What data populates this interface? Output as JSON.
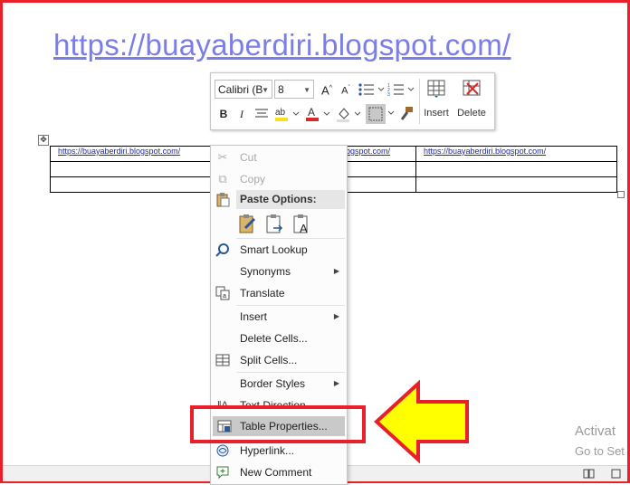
{
  "document": {
    "heading_link": "https://buayaberdiri.blogspot.com/",
    "table_cells": [
      [
        "https://buayaberdiri.blogspot.com/",
        "https://buayaberdiri.blogspot.com/",
        "https://buayaberdiri.blogspot.com/"
      ],
      [
        "",
        "",
        ""
      ],
      [
        "",
        "",
        ""
      ]
    ],
    "middle_cell_visible": "logspot.com/"
  },
  "mini_toolbar": {
    "font_name": "Calibri (B",
    "font_size": "8",
    "insert_label": "Insert",
    "delete_label": "Delete",
    "font_color": "#d42a2a",
    "highlight_color": "#f5e11c"
  },
  "context_menu": {
    "items": [
      {
        "label": "Cut",
        "icon": "scissors-icon",
        "disabled": true
      },
      {
        "label": "Copy",
        "icon": "copy-icon",
        "disabled": true
      },
      {
        "label": "Paste Options:",
        "icon": "paste-icon",
        "header": true
      },
      {
        "label": "Smart Lookup",
        "icon": "search-icon"
      },
      {
        "label": "Synonyms",
        "submenu": true
      },
      {
        "label": "Translate",
        "icon": "translate-icon"
      },
      {
        "label": "Insert",
        "submenu": true
      },
      {
        "label": "Delete Cells..."
      },
      {
        "label": "Split Cells...",
        "icon": "split-cells-icon"
      },
      {
        "label": "Border Styles",
        "submenu": true
      },
      {
        "label": "Text Direction...",
        "icon": "text-direction-icon"
      },
      {
        "label": "Table Properties...",
        "icon": "table-properties-icon",
        "highlighted": true
      },
      {
        "label": "Hyperlink...",
        "icon": "link-icon"
      },
      {
        "label": "New Comment",
        "icon": "comment-icon"
      }
    ]
  },
  "activation": {
    "line1": "Activat",
    "line2": "Go to Set"
  },
  "colors": {
    "annotation_red": "#e8202a",
    "arrow_yellow": "#ffff00",
    "link_color": "#7b7de8"
  }
}
